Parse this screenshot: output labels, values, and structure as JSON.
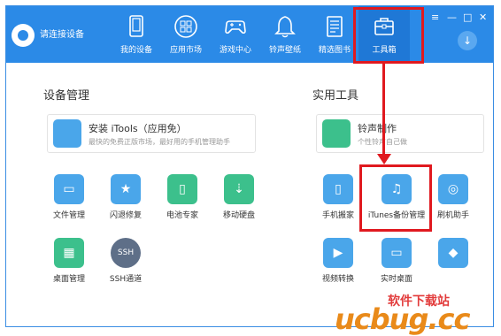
{
  "header": {
    "connect_text": "请连接设备",
    "nav": [
      {
        "label": "我的设备",
        "icon": "tablet-icon"
      },
      {
        "label": "应用市场",
        "icon": "apps-icon"
      },
      {
        "label": "游戏中心",
        "icon": "gamepad-icon"
      },
      {
        "label": "铃声壁纸",
        "icon": "bell-icon"
      },
      {
        "label": "精选图书",
        "icon": "book-icon"
      },
      {
        "label": "工具箱",
        "icon": "toolbox-icon"
      }
    ],
    "window_controls": {
      "menu": "≡",
      "minimize": "—",
      "maximize": "□",
      "close": "✕"
    },
    "download_symbol": "↓"
  },
  "left": {
    "title": "设备管理",
    "card": {
      "title": "安装 iTools（应用免）",
      "desc": "最快的免费正版市场，最好用的手机管理助手"
    },
    "tools": [
      {
        "label": "文件管理",
        "color": "#4aa6ea",
        "symbol": "▭"
      },
      {
        "label": "闪退修复",
        "color": "#4aa6ea",
        "symbol": "★"
      },
      {
        "label": "电池专家",
        "color": "#3cc08c",
        "symbol": "▯"
      },
      {
        "label": "移动硬盘",
        "color": "#3cc08c",
        "symbol": "⇣"
      },
      {
        "label": "桌面管理",
        "color": "#3cc08c",
        "symbol": "▦"
      },
      {
        "label": "SSH通道",
        "color": "#5e6f88",
        "symbol": "SSH"
      }
    ]
  },
  "right": {
    "title": "实用工具",
    "card": {
      "title": "铃声制作",
      "desc": "个性铃声自己做"
    },
    "tools": [
      {
        "label": "手机搬家",
        "color": "#4aa6ea",
        "symbol": "▯"
      },
      {
        "label": "iTunes备份管理",
        "color": "#4aa6ea",
        "symbol": "♫"
      },
      {
        "label": "刷机助手",
        "color": "#4aa6ea",
        "symbol": "◎"
      },
      {
        "label": "视频转换",
        "color": "#4aa6ea",
        "symbol": "▶"
      },
      {
        "label": "实时桌面",
        "color": "#4aa6ea",
        "symbol": "▭"
      },
      {
        "label": "",
        "color": "#4aa6ea",
        "symbol": "◆"
      }
    ]
  },
  "watermark": {
    "line1": "软件下载站",
    "line2": "ucbug.cc"
  },
  "colors": {
    "header_blue": "#2b8ae7",
    "highlight_red": "#e0191f"
  }
}
